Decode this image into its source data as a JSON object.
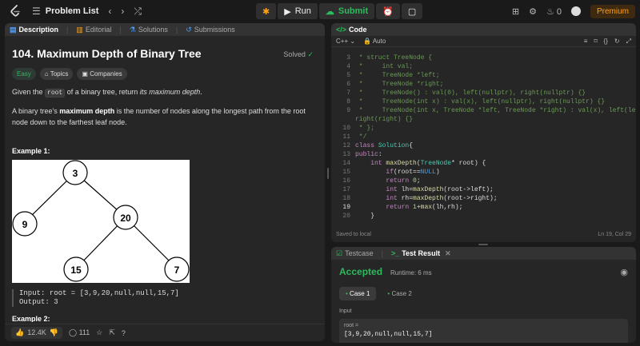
{
  "topbar": {
    "problem_list": "Problem List",
    "run": "Run",
    "submit": "Submit",
    "streak_count": "0",
    "premium": "Premium"
  },
  "left_tabs": {
    "description": "Description",
    "editorial": "Editorial",
    "solutions": "Solutions",
    "submissions": "Submissions"
  },
  "problem": {
    "title": "104. Maximum Depth of Binary Tree",
    "status": "Solved",
    "difficulty": "Easy",
    "tag_topics": "Topics",
    "tag_companies": "Companies",
    "p1_a": "Given the ",
    "p1_code": "root",
    "p1_b": " of a binary tree, return ",
    "p1_c": "its maximum depth",
    "p1_d": ".",
    "p2_a": "A binary tree's ",
    "p2_b": "maximum depth",
    "p2_c": " is the number of nodes along the longest path from the root node down to the farthest leaf node.",
    "example1": "Example 1:",
    "input_line": "Input: root = [3,9,20,null,null,15,7]",
    "output_line": "Output: 3",
    "example2": "Example 2:",
    "tree_nodes": [
      "3",
      "9",
      "20",
      "15",
      "7"
    ]
  },
  "left_bottom": {
    "likes": "12.4K",
    "comments": "111"
  },
  "code_panel": {
    "title": "Code",
    "language": "C++",
    "auto": "Auto",
    "saved": "Saved to local",
    "position": "Ln 19, Col 29",
    "current_line": 19
  },
  "result_panel": {
    "tab_testcase": "Testcase",
    "tab_result": "Test Result",
    "verdict": "Accepted",
    "runtime": "Runtime: 6 ms",
    "case1": "Case 1",
    "case2": "Case 2",
    "input_label": "Input",
    "input_var": "root =",
    "input_value": "[3,9,20,null,null,15,7]"
  },
  "colors": {
    "accent_green": "#2cbb5d",
    "premium_orange": "#ffa116"
  }
}
